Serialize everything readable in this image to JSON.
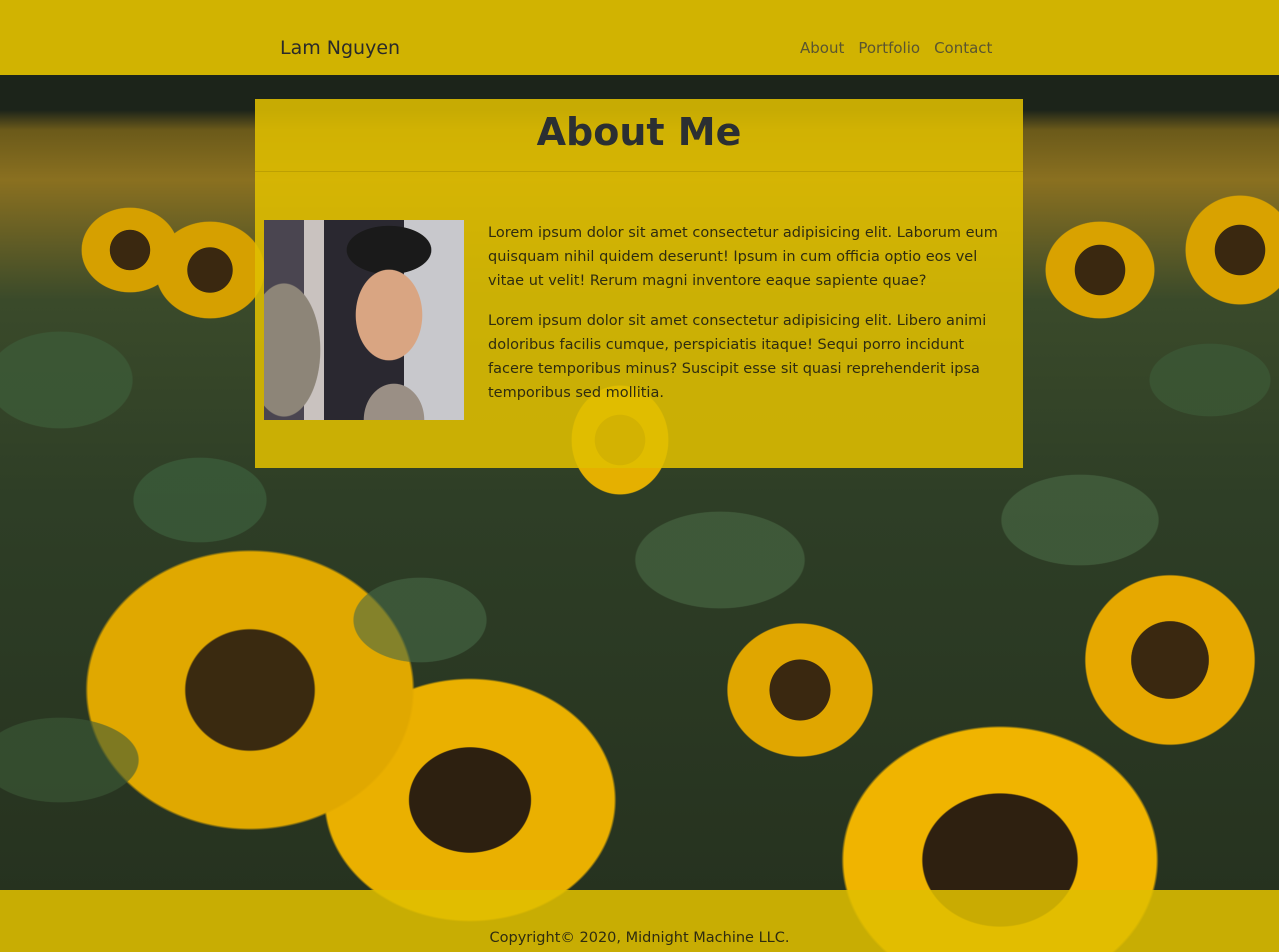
{
  "navbar": {
    "brand": "Lam Nguyen",
    "links": [
      "About",
      "Portfolio",
      "Contact"
    ]
  },
  "about": {
    "title": "About Me",
    "photo_alt": "portrait photo",
    "paragraphs": [
      "Lorem ipsum dolor sit amet consectetur adipisicing elit. Laborum eum quisquam nihil quidem deserunt! Ipsum in cum officia optio eos vel vitae ut velit! Rerum magni inventore eaque sapiente quae?",
      "Lorem ipsum dolor sit amet consectetur adipisicing elit. Libero animi doloribus facilis cumque, perspiciatis itaque! Sequi porro incidunt facere temporibus minus? Suscipit esse sit quasi reprehenderit ipsa temporibus sed mollitia."
    ]
  },
  "footer": {
    "text": "Copyright© 2020, Midnight Machine LLC."
  },
  "colors": {
    "accent": "#dfbe00",
    "text_dark": "#2b2f32"
  }
}
